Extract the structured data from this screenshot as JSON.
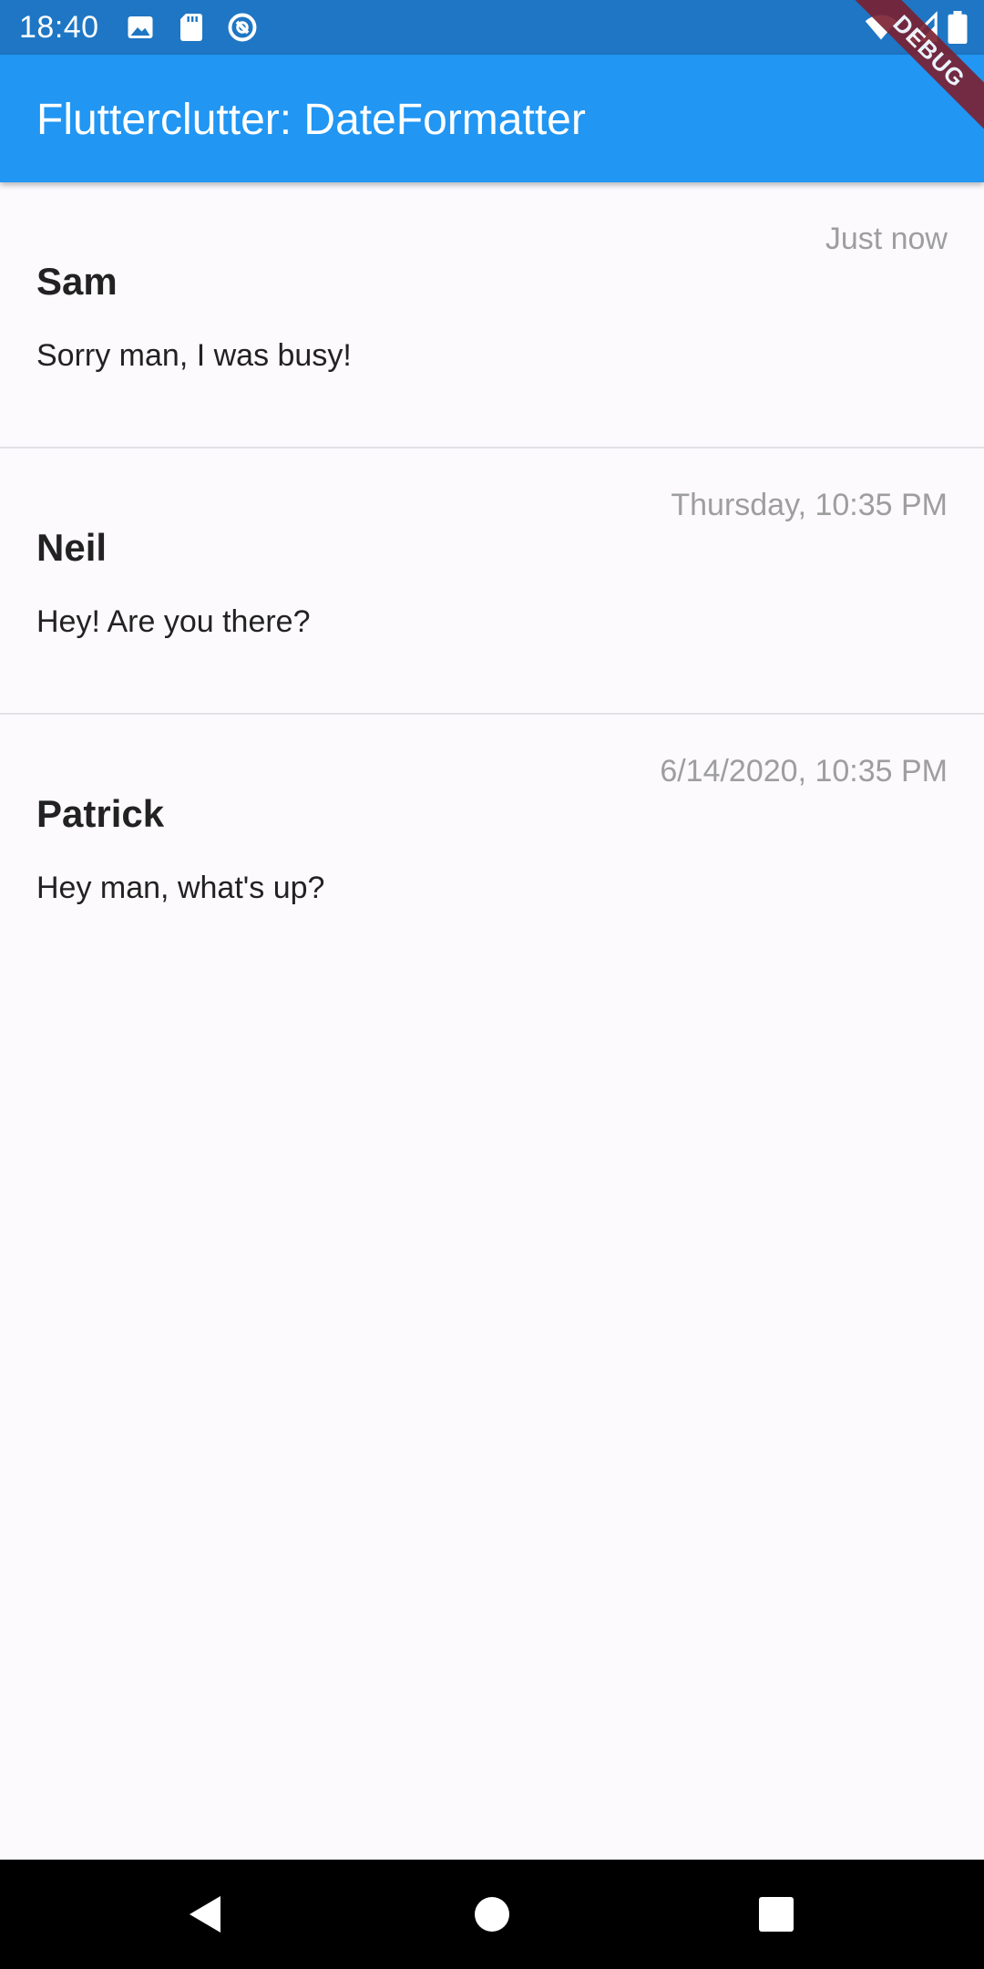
{
  "status_bar": {
    "time": "18:40",
    "icons_left": [
      "image-icon",
      "sd-card-icon",
      "sync-icon"
    ],
    "icons_right": [
      "wifi-icon",
      "cell-signal-icon",
      "battery-icon"
    ]
  },
  "app_bar": {
    "title": "Flutterclutter: DateFormatter"
  },
  "debug_banner": {
    "label": "DEBUG"
  },
  "messages": [
    {
      "sender": "Sam",
      "text": "Sorry man, I was busy!",
      "time": "Just now"
    },
    {
      "sender": "Neil",
      "text": "Hey! Are you there?",
      "time": "Thursday, 10:35 PM"
    },
    {
      "sender": "Patrick",
      "text": "Hey man, what's up?",
      "time": "6/14/2020, 10:35 PM"
    }
  ],
  "nav_bar": {
    "buttons": [
      "back-icon",
      "home-icon",
      "recents-icon"
    ]
  },
  "colors": {
    "status_bar": "#1E76C4",
    "app_bar": "#2196F3",
    "background": "#FCFAFD",
    "timestamp": "#9E9E9E",
    "text": "#222222",
    "debug_ribbon": "#7B2030"
  }
}
